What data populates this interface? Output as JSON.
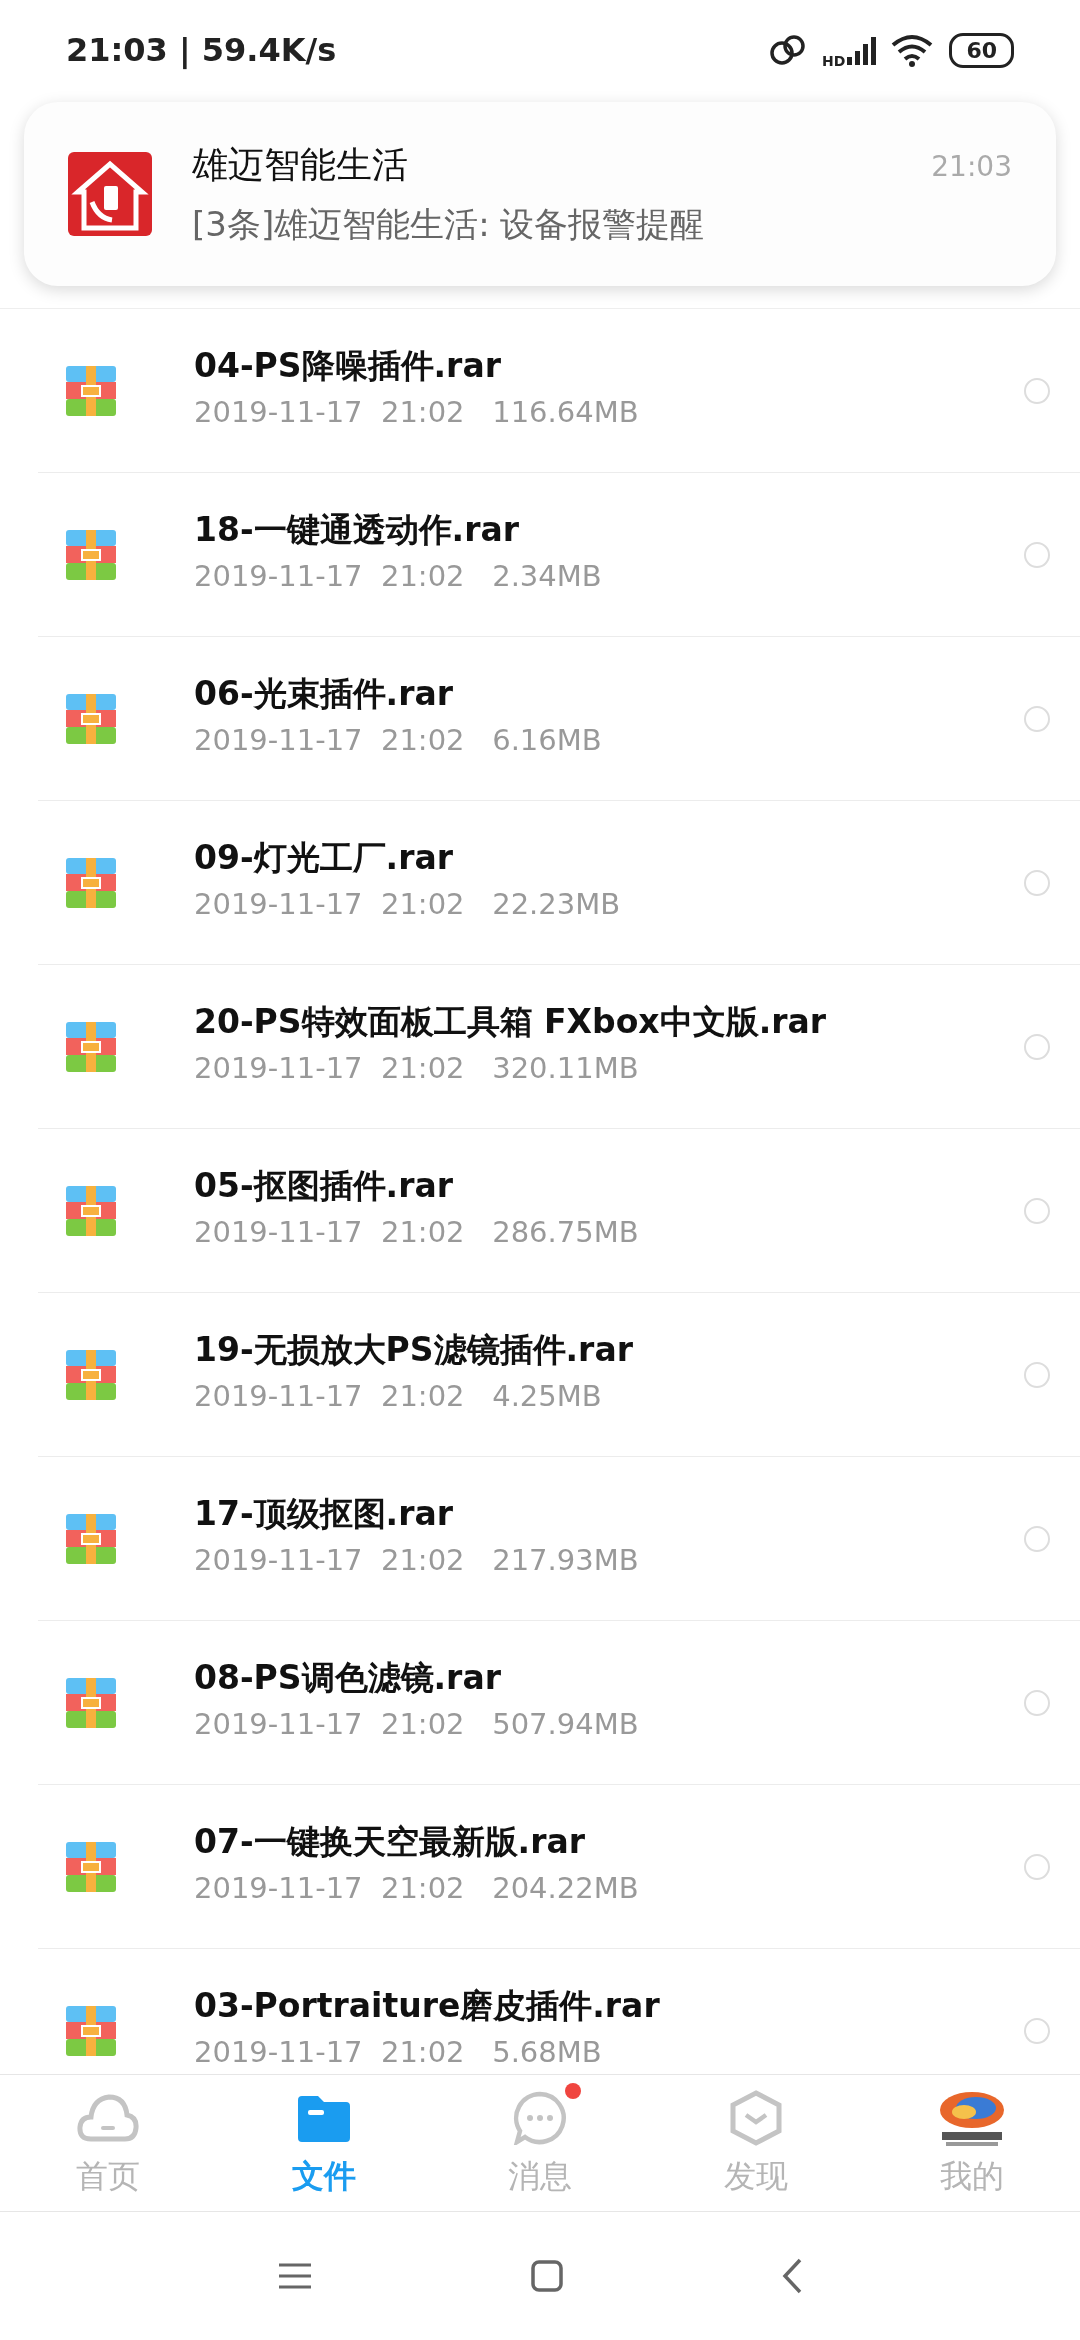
{
  "status_bar": {
    "time": "21:03 | 59.4K/s",
    "network": "HD",
    "battery": "60"
  },
  "notification": {
    "app": "雄迈智能生活",
    "text": "[3条]雄迈智能生活: 设备报警提醒",
    "time": "21:03"
  },
  "files": [
    {
      "name": "04-PS降噪插件.rar",
      "date": "2019-11-17",
      "time": "21:02",
      "size": "116.64MB",
      "selected": false
    },
    {
      "name": "18-一键通透动作.rar",
      "date": "2019-11-17",
      "time": "21:02",
      "size": "2.34MB",
      "selected": false
    },
    {
      "name": "06-光束插件.rar",
      "date": "2019-11-17",
      "time": "21:02",
      "size": "6.16MB",
      "selected": false
    },
    {
      "name": "09-灯光工厂.rar",
      "date": "2019-11-17",
      "time": "21:02",
      "size": "22.23MB",
      "selected": false
    },
    {
      "name": "20-PS特效面板工具箱 FXbox中文版.rar",
      "date": "2019-11-17",
      "time": "21:02",
      "size": "320.11MB",
      "selected": false
    },
    {
      "name": "05-抠图插件.rar",
      "date": "2019-11-17",
      "time": "21:02",
      "size": "286.75MB",
      "selected": false
    },
    {
      "name": "19-无损放大PS滤镜插件.rar",
      "date": "2019-11-17",
      "time": "21:02",
      "size": "4.25MB",
      "selected": false
    },
    {
      "name": "17-顶级抠图.rar",
      "date": "2019-11-17",
      "time": "21:02",
      "size": "217.93MB",
      "selected": false
    },
    {
      "name": "08-PS调色滤镜.rar",
      "date": "2019-11-17",
      "time": "21:02",
      "size": "507.94MB",
      "selected": false
    },
    {
      "name": "07-一键换天空最新版.rar",
      "date": "2019-11-17",
      "time": "21:02",
      "size": "204.22MB",
      "selected": false
    },
    {
      "name": "03-Portraiture磨皮插件.rar",
      "date": "2019-11-17",
      "time": "21:02",
      "size": "5.68MB",
      "selected": false
    }
  ],
  "bottom_nav": [
    {
      "label": "首页",
      "selected": false,
      "dot": false
    },
    {
      "label": "文件",
      "selected": true,
      "dot": false
    },
    {
      "label": "消息",
      "selected": false,
      "dot": true
    },
    {
      "label": "发现",
      "selected": false,
      "dot": false
    },
    {
      "label": "我的",
      "selected": false,
      "dot": false
    }
  ]
}
